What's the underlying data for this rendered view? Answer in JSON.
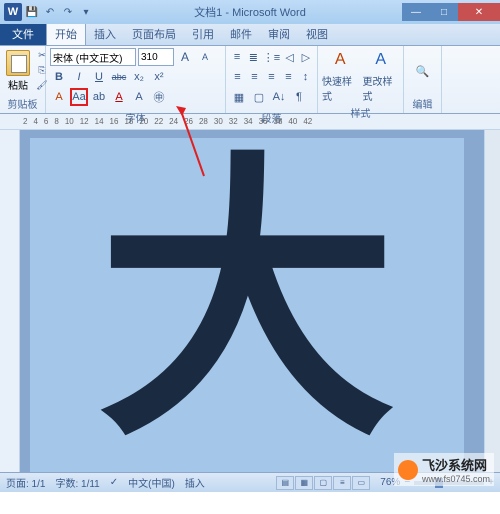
{
  "titlebar": {
    "app_icon": "W",
    "title": "文档1 - Microsoft Word"
  },
  "tabs": {
    "file": "文件",
    "items": [
      "开始",
      "插入",
      "页面布局",
      "引用",
      "邮件",
      "审阅",
      "视图"
    ],
    "active_index": 0
  },
  "ribbon": {
    "clipboard": {
      "label": "剪贴板",
      "paste": "粘贴"
    },
    "font": {
      "label": "字体",
      "name": "宋体 (中文正文)",
      "size": "310",
      "grow": "A",
      "shrink": "A",
      "bold": "B",
      "italic": "I",
      "underline": "U",
      "strike": "abc",
      "sub": "x₂",
      "sup": "x²",
      "case": "Aa",
      "highlight": "ab",
      "color": "A"
    },
    "paragraph": {
      "label": "段落"
    },
    "styles": {
      "label": "样式",
      "quick": "快速样式",
      "change": "更改样式",
      "letter": "A"
    },
    "editing": {
      "label": "编辑"
    }
  },
  "ruler": {
    "ticks": [
      "2",
      "4",
      "6",
      "8",
      "10",
      "12",
      "14",
      "16",
      "18",
      "20",
      "22",
      "24",
      "26",
      "28",
      "30",
      "32",
      "34",
      "36",
      "38",
      "40",
      "42"
    ]
  },
  "document": {
    "character": "大"
  },
  "statusbar": {
    "page": "页面: 1/1",
    "words": "字数: 1/11",
    "lang": "中文(中国)",
    "mode": "插入",
    "zoom": "76%",
    "minus": "−",
    "plus": "+"
  },
  "watermark": {
    "name": "飞沙系统网",
    "url": "www.fs0745.com"
  }
}
